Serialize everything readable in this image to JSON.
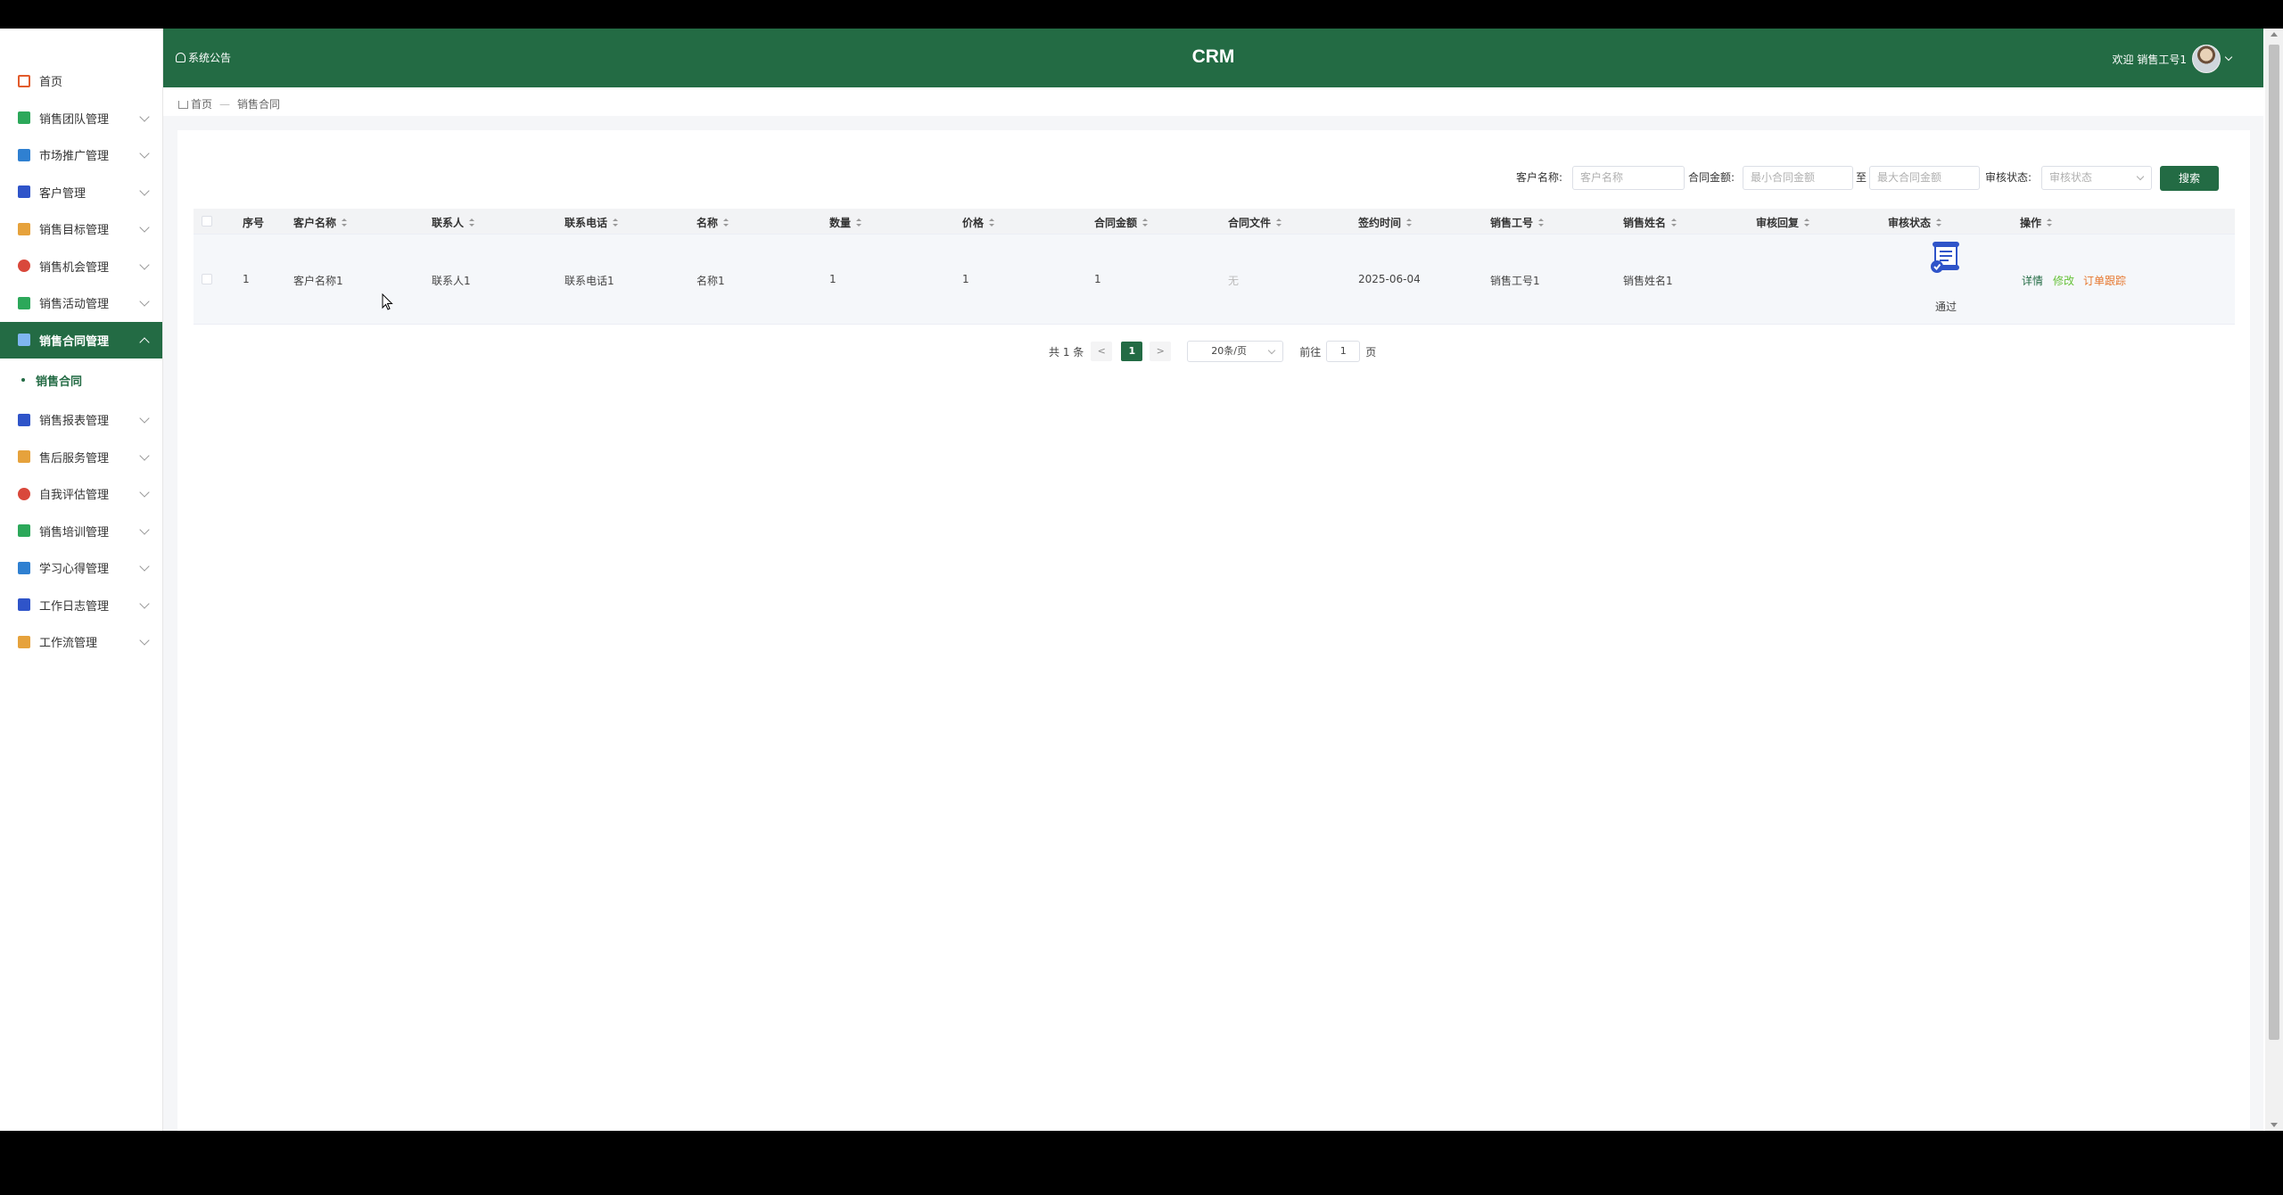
{
  "colors": {
    "primary": "#236b44",
    "action_danger": "#e6a23c"
  },
  "sidebar": {
    "items": [
      {
        "label": "首页",
        "icon": "home-icon",
        "color": "#e25b2c"
      },
      {
        "label": "销售团队管理",
        "icon": "team-icon",
        "color": "#2ca85a"
      },
      {
        "label": "市场推广管理",
        "icon": "promo-icon",
        "color": "#2f80d1"
      },
      {
        "label": "客户管理",
        "icon": "customer-icon",
        "color": "#2f54c9"
      },
      {
        "label": "销售目标管理",
        "icon": "target-icon",
        "color": "#e6a23c"
      },
      {
        "label": "销售机会管理",
        "icon": "opportunity-icon",
        "color": "#d9483b"
      },
      {
        "label": "销售活动管理",
        "icon": "activity-icon",
        "color": "#2ca85a"
      },
      {
        "label": "销售合同管理",
        "icon": "contract-icon",
        "color": "#2f80d1",
        "active": true
      },
      {
        "label": "销售报表管理",
        "icon": "report-icon",
        "color": "#2f54c9"
      },
      {
        "label": "售后服务管理",
        "icon": "service-icon",
        "color": "#e6a23c"
      },
      {
        "label": "自我评估管理",
        "icon": "assess-icon",
        "color": "#d9483b"
      },
      {
        "label": "销售培训管理",
        "icon": "training-icon",
        "color": "#2ca85a"
      },
      {
        "label": "学习心得管理",
        "icon": "study-icon",
        "color": "#2f80d1"
      },
      {
        "label": "工作日志管理",
        "icon": "log-icon",
        "color": "#2f54c9"
      },
      {
        "label": "工作流管理",
        "icon": "workflow-icon",
        "color": "#e6a23c"
      }
    ],
    "submenu": {
      "label": "销售合同"
    }
  },
  "topbar": {
    "notice": "系统公告",
    "title": "CRM",
    "welcome": "欢迎 销售工号1"
  },
  "breadcrumb": {
    "home": "首页",
    "separator": "—",
    "current": "销售合同"
  },
  "filters": {
    "customer_label": "客户名称:",
    "customer_placeholder": "客户名称",
    "amount_label": "合同金额:",
    "amount_min_placeholder": "最小合同金额",
    "amount_to": "至",
    "amount_max_placeholder": "最大合同金额",
    "status_label": "审核状态:",
    "status_placeholder": "审核状态",
    "search_label": "搜索"
  },
  "table": {
    "columns": [
      "序号",
      "客户名称",
      "联系人",
      "联系电话",
      "名称",
      "数量",
      "价格",
      "合同金额",
      "合同文件",
      "签约时间",
      "销售工号",
      "销售姓名",
      "审核回复",
      "审核状态",
      "操作"
    ],
    "rows": [
      {
        "index": "1",
        "customer": "客户名称1",
        "contact": "联系人1",
        "phone": "联系电话1",
        "name": "名称1",
        "qty": "1",
        "price": "1",
        "amount": "1",
        "file": "无",
        "sign_date": "2025-06-04",
        "sales_id": "销售工号1",
        "sales_name": "销售姓名1",
        "review_reply": "",
        "status_icon": "approved-document-icon",
        "status": "通过",
        "actions": {
          "detail": "详情",
          "edit": "修改",
          "track": "订单跟踪"
        }
      }
    ]
  },
  "pagination": {
    "total": "共 1 条",
    "prev": "<",
    "current": "1",
    "next": ">",
    "page_size": "20条/页",
    "goto_prefix": "前往",
    "goto_value": "1",
    "goto_suffix": "页"
  }
}
